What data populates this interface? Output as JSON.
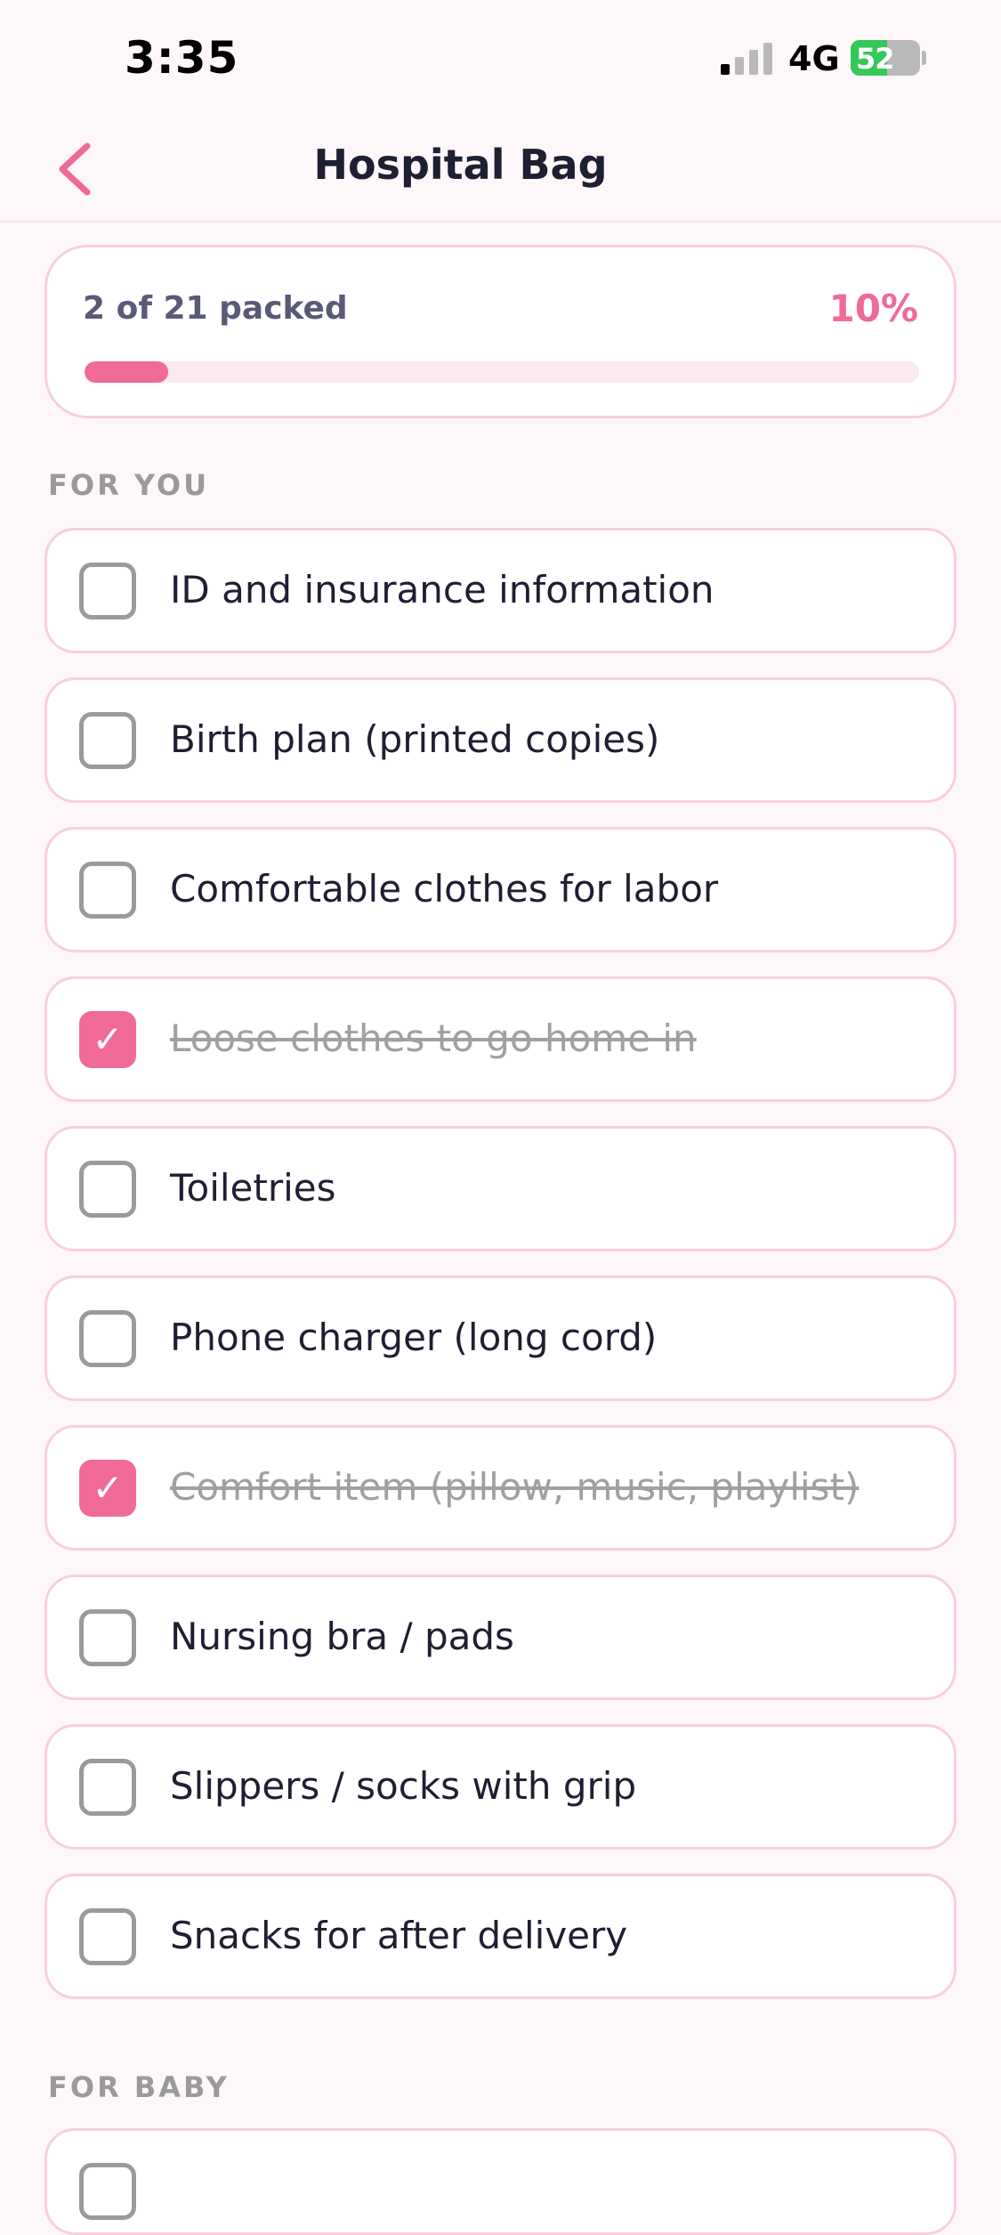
{
  "status_bar": {
    "time": "3:35",
    "network": "4G",
    "battery": "52"
  },
  "nav": {
    "title": "Hospital Bag"
  },
  "progress": {
    "label": "2 of 21 packed",
    "percent_label": "10%",
    "fraction": 0.1
  },
  "sections": [
    {
      "title": "FOR YOU",
      "items": [
        {
          "label": "ID and insurance information",
          "checked": false
        },
        {
          "label": "Birth plan (printed copies)",
          "checked": false
        },
        {
          "label": "Comfortable clothes for labor",
          "checked": false
        },
        {
          "label": "Loose clothes to go home in",
          "checked": true
        },
        {
          "label": "Toiletries",
          "checked": false
        },
        {
          "label": "Phone charger (long cord)",
          "checked": false
        },
        {
          "label": "Comfort item (pillow, music, playlist)",
          "checked": true
        },
        {
          "label": "Nursing bra / pads",
          "checked": false
        },
        {
          "label": "Slippers / socks with grip",
          "checked": false
        },
        {
          "label": "Snacks for after delivery",
          "checked": false
        }
      ]
    },
    {
      "title": "FOR BABY",
      "items": []
    }
  ],
  "colors": {
    "accent": "#F06A98",
    "card_border": "#F9CFDD",
    "background": "#FDF7F9"
  },
  "icons": {
    "back": "chevron-left-icon",
    "check": "checkmark-icon"
  }
}
